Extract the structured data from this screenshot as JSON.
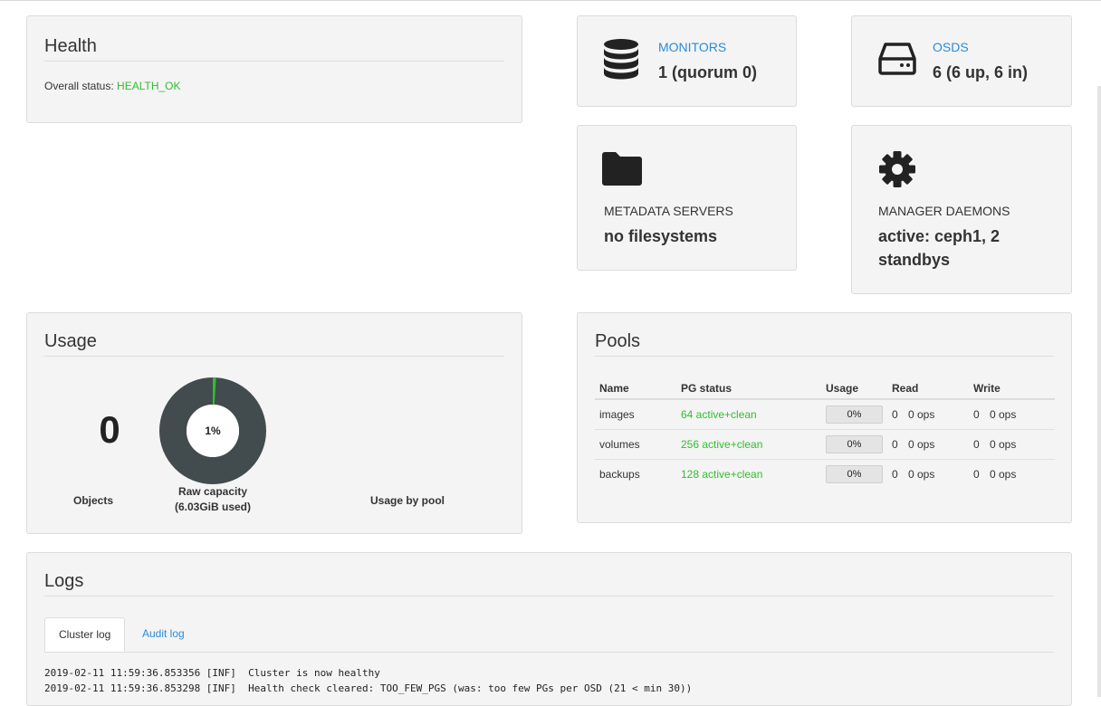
{
  "health": {
    "title": "Health",
    "status_label": "Overall status:",
    "status_value": "HEALTH_OK"
  },
  "monitors": {
    "label": "MONITORS",
    "value": "1 (quorum 0)",
    "icon": "database-icon"
  },
  "osds": {
    "label": "OSDS",
    "value": "6 (6 up, 6 in)",
    "icon": "hard-drive-icon"
  },
  "mds": {
    "label": "METADATA SERVERS",
    "value": "no filesystems",
    "icon": "folder-icon"
  },
  "mgr": {
    "label": "MANAGER DAEMONS",
    "value_line1": "active: ceph1, 2",
    "value_line2": "standbys",
    "icon": "gear-icon"
  },
  "usage": {
    "title": "Usage",
    "objects_value": "0",
    "objects_label": "Objects",
    "raw_capacity_percent": "1%",
    "raw_capacity_fraction": 0.01,
    "raw_capacity_label": "Raw capacity",
    "raw_capacity_used": "(6.03GiB used)",
    "usage_by_pool_label": "Usage by pool",
    "colors": {
      "ring": "#424b4d",
      "used": "#2fbf2f"
    }
  },
  "pools": {
    "title": "Pools",
    "headers": {
      "name": "Name",
      "pg": "PG status",
      "usage": "Usage",
      "read": "Read",
      "write": "Write"
    },
    "rows": [
      {
        "name": "images",
        "pg": "64 active+clean",
        "usage": "0%",
        "read_n": "0",
        "read_ops": "0 ops",
        "write_n": "0",
        "write_ops": "0 ops"
      },
      {
        "name": "volumes",
        "pg": "256 active+clean",
        "usage": "0%",
        "read_n": "0",
        "read_ops": "0 ops",
        "write_n": "0",
        "write_ops": "0 ops"
      },
      {
        "name": "backups",
        "pg": "128 active+clean",
        "usage": "0%",
        "read_n": "0",
        "read_ops": "0 ops",
        "write_n": "0",
        "write_ops": "0 ops"
      }
    ]
  },
  "logs": {
    "title": "Logs",
    "tabs": [
      "Cluster log",
      "Audit log"
    ],
    "lines": [
      "2019-02-11 11:59:36.853356 [INF]  Cluster is now healthy",
      "2019-02-11 11:59:36.853298 [INF]  Health check cleared: TOO_FEW_PGS (was: too few PGs per OSD (21 < min 30))"
    ]
  }
}
